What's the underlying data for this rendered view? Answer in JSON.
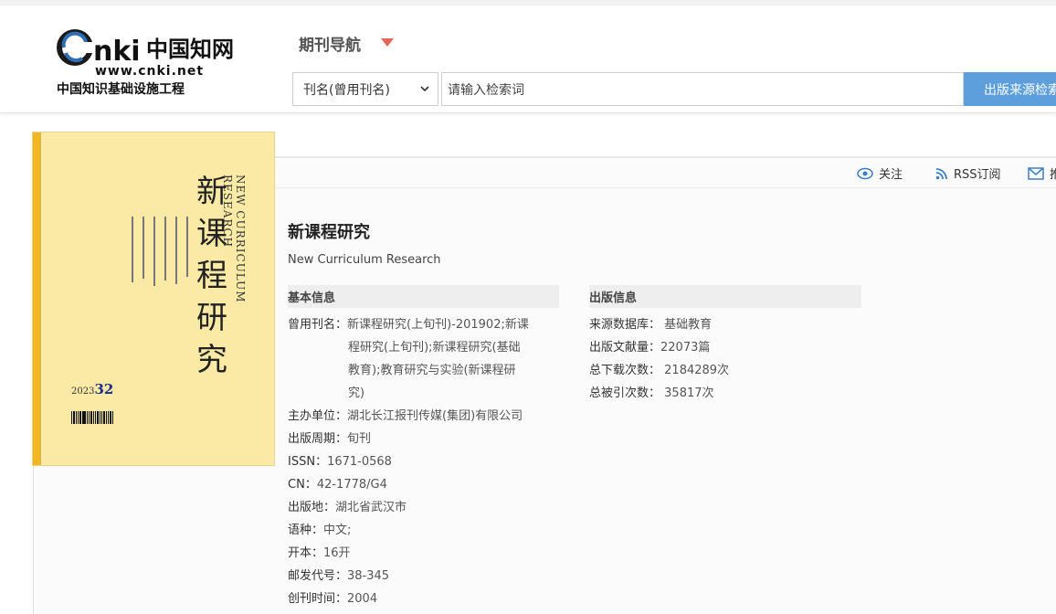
{
  "header": {
    "logo": {
      "brand": "CNKI中国知网",
      "url_text": "www.cnki.net",
      "tagline": "中国知识基础设施工程"
    },
    "nav_title": "期刊导航",
    "search": {
      "select_value": "刊名(曾用刊名)",
      "placeholder": "请输入检索词",
      "button_label": "出版来源检索"
    }
  },
  "toolbar": {
    "follow": "关注",
    "rss": "RSS订阅",
    "email": "推荐"
  },
  "cover": {
    "title": "新课程研究",
    "title_chars": [
      "新",
      "课",
      "程",
      "研",
      "究"
    ],
    "title_en": "NEW CURRICULUM RESEARCH",
    "year": "2023",
    "issue": "32"
  },
  "journal": {
    "title": "新课程研究",
    "title_en": "New Curriculum Research"
  },
  "basic_info": {
    "heading": "基本信息",
    "former_names_label": "曾用刊名：",
    "former_names_lines": [
      "新课程研究(上旬刊)-201902;新课",
      "程研究(上旬刊);新课程研究(基础",
      "教育);教育研究与实验(新课程研",
      "究)"
    ],
    "items": [
      {
        "label": "主办单位：",
        "value": "湖北长江报刊传媒(集团)有限公司"
      },
      {
        "label": "出版周期：",
        "value": "旬刊"
      },
      {
        "label": "ISSN：",
        "value": "1671-0568"
      },
      {
        "label": "CN：",
        "value": "42-1778/G4"
      },
      {
        "label": "出版地：",
        "value": "湖北省武汉市"
      },
      {
        "label": "语种：",
        "value": "中文;"
      },
      {
        "label": "开本：",
        "value": "16开"
      },
      {
        "label": "邮发代号：",
        "value": "38-345"
      },
      {
        "label": "创刊时间：",
        "value": "2004"
      }
    ]
  },
  "pub_info": {
    "heading": "出版信息",
    "items": [
      {
        "label": "来源数据库：",
        "value": "基础教育"
      },
      {
        "label": "出版文献量：",
        "value": "22073篇"
      },
      {
        "label": "总下载次数：",
        "value": "2184289次"
      },
      {
        "label": "总被引次数：",
        "value": "35817次"
      }
    ]
  },
  "colors": {
    "search_button": "#5d9fdd",
    "nav_caret": "#e5665a",
    "cover_bg": "#fbeaa6",
    "cover_spine": "#f0b722"
  }
}
